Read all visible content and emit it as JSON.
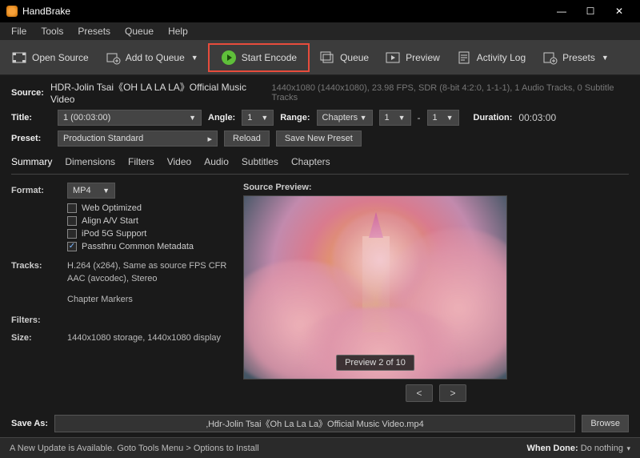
{
  "window": {
    "title": "HandBrake"
  },
  "menu": [
    "File",
    "Tools",
    "Presets",
    "Queue",
    "Help"
  ],
  "toolbar": {
    "open": "Open Source",
    "addqueue": "Add to Queue",
    "encode": "Start Encode",
    "queue": "Queue",
    "preview": "Preview",
    "activity": "Activity Log",
    "presets": "Presets"
  },
  "source": {
    "label": "Source:",
    "name": "HDR-Jolin Tsai《OH LA LA LA》Official Music Video",
    "meta": "1440x1080 (1440x1080), 23.98 FPS, SDR (8-bit 4:2:0, 1-1-1), 1 Audio Tracks, 0 Subtitle Tracks"
  },
  "title": {
    "label": "Title:",
    "value": "1  (00:03:00)"
  },
  "angle": {
    "label": "Angle:",
    "value": "1"
  },
  "range": {
    "label": "Range:",
    "type": "Chapters",
    "from": "1",
    "sep": "-",
    "to": "1"
  },
  "duration": {
    "label": "Duration:",
    "value": "00:03:00"
  },
  "preset": {
    "label": "Preset:",
    "value": "Production Standard",
    "reload": "Reload",
    "savenew": "Save New Preset"
  },
  "tabs": [
    "Summary",
    "Dimensions",
    "Filters",
    "Video",
    "Audio",
    "Subtitles",
    "Chapters"
  ],
  "summary": {
    "formatLabel": "Format:",
    "formatValue": "MP4",
    "cb_web": "Web Optimized",
    "cb_align": "Align A/V Start",
    "cb_ipod": "iPod 5G Support",
    "cb_meta": "Passthru Common Metadata",
    "tracksLabel": "Tracks:",
    "track_v": "H.264 (x264), Same as source FPS CFR",
    "track_a": "AAC (avcodec), Stereo",
    "track_c": "Chapter Markers",
    "filtersLabel": "Filters:",
    "sizeLabel": "Size:",
    "sizeValue": "1440x1080 storage, 1440x1080 display"
  },
  "preview": {
    "title": "Source Preview:",
    "label": "Preview 2 of 10",
    "prev": "<",
    "next": ">"
  },
  "save": {
    "label": "Save As:",
    "value": "‚Hdr-Jolin Tsai《Oh La La La》Official Music Video.mp4",
    "browse": "Browse"
  },
  "footer": {
    "left": "A New Update is Available. Goto Tools Menu > Options to Install",
    "rightLabel": "When Done:",
    "rightValue": "Do nothing"
  }
}
